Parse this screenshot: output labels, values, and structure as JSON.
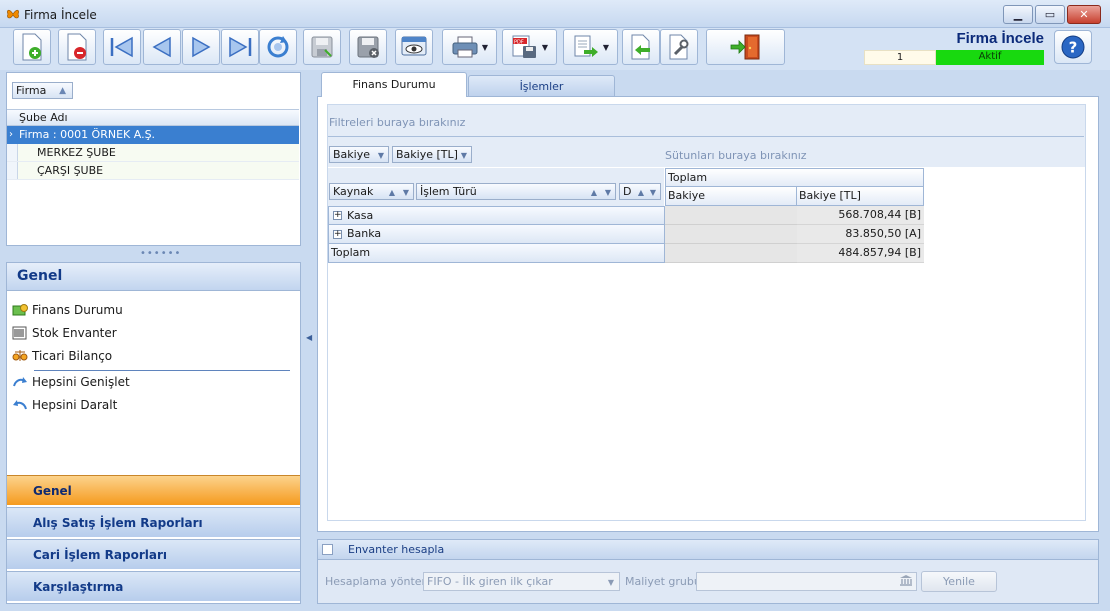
{
  "window": {
    "title": "Firma İncele",
    "controls": [
      "minimize",
      "maximize",
      "close"
    ]
  },
  "toolbar": {
    "buttons": [
      {
        "id": "new",
        "icon": "new-document-icon"
      },
      {
        "id": "delete",
        "icon": "delete-document-icon"
      },
      {
        "id": "first",
        "icon": "first-record-icon"
      },
      {
        "id": "prev",
        "icon": "previous-record-icon"
      },
      {
        "id": "next",
        "icon": "next-record-icon"
      },
      {
        "id": "last",
        "icon": "last-record-icon"
      },
      {
        "id": "refresh",
        "icon": "refresh-icon"
      },
      {
        "id": "save",
        "icon": "save-icon",
        "disabled": true
      },
      {
        "id": "save-close",
        "icon": "save-close-icon",
        "disabled": true
      },
      {
        "id": "preview",
        "icon": "preview-icon"
      },
      {
        "id": "print",
        "icon": "printer-icon",
        "dropdown": true
      },
      {
        "id": "export-pdf",
        "icon": "pdf-export-icon",
        "dropdown": true
      },
      {
        "id": "export",
        "icon": "export-icon",
        "dropdown": true
      },
      {
        "id": "import",
        "icon": "import-icon"
      },
      {
        "id": "settings",
        "icon": "wrench-icon"
      },
      {
        "id": "exit",
        "icon": "exit-door-icon"
      }
    ]
  },
  "header": {
    "title": "Firma İncele",
    "record_no": "1",
    "status": "Aktif",
    "status_color": "#18d90f",
    "help_icon": "help-icon"
  },
  "left": {
    "group_chip": "Firma",
    "grid_column": "Şube Adı",
    "selected_row": "Firma : 0001 ÖRNEK A.Ş.",
    "rows": [
      "MERKEZ ŞUBE",
      "ÇARŞI ŞUBE"
    ]
  },
  "nav": {
    "header": "Genel",
    "items": [
      {
        "label": "Finans Durumu",
        "icon": "finance-icon"
      },
      {
        "label": "Stok Envanter",
        "icon": "inventory-icon"
      },
      {
        "label": "Ticari Bilanço",
        "icon": "balance-icon"
      },
      {
        "label": "Hepsini Genişlet",
        "icon": "expand-all-icon"
      },
      {
        "label": "Hepsini Daralt",
        "icon": "collapse-all-icon"
      }
    ],
    "groups": [
      "Genel",
      "Alış Satış İşlem Raporları",
      "Cari İşlem Raporları",
      "Karşılaştırma"
    ]
  },
  "tabs": [
    {
      "label": "Finans Durumu",
      "active": true
    },
    {
      "label": "İşlemler",
      "active": false
    }
  ],
  "pivot": {
    "filter_drop_text": "Filtreleri buraya bırakınız",
    "column_drop_text": "Sütunları buraya bırakınız",
    "data_chips": [
      "Bakiye",
      "Bakiye [TL]"
    ],
    "row_chips": [
      "Kaynak",
      "İşlem Türü",
      "D"
    ],
    "column_group": "Toplam",
    "columns": [
      "Bakiye",
      "Bakiye [TL]"
    ],
    "rows": [
      {
        "label": "Kasa",
        "bakiye": "",
        "bakiye_tl": "568.708,44 [B]",
        "expandable": true
      },
      {
        "label": "Banka",
        "bakiye": "",
        "bakiye_tl": "83.850,50 [A]",
        "expandable": true
      },
      {
        "label": "Toplam",
        "bakiye": "",
        "bakiye_tl": "484.857,94 [B]",
        "expandable": false
      }
    ]
  },
  "inventory": {
    "checkbox_label": "Envanter hesapla",
    "method_label": "Hesaplama yöntemi",
    "method_value": "FIFO - İlk giren ilk çıkar",
    "cost_group_label": "Maliyet grubu",
    "cost_group_value": "",
    "refresh_label": "Yenile"
  }
}
